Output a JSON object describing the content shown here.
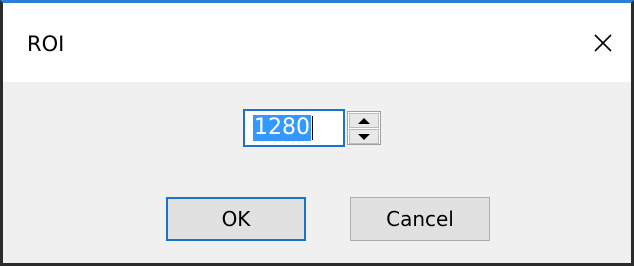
{
  "window": {
    "title": "ROI",
    "close_icon": "close-icon",
    "accent_color": "#2b7fd6"
  },
  "spinbox": {
    "value": "1280",
    "up_icon": "triangle-up-icon",
    "down_icon": "triangle-down-icon",
    "selection_color": "#3399ff"
  },
  "buttons": {
    "ok_label": "OK",
    "cancel_label": "Cancel"
  }
}
